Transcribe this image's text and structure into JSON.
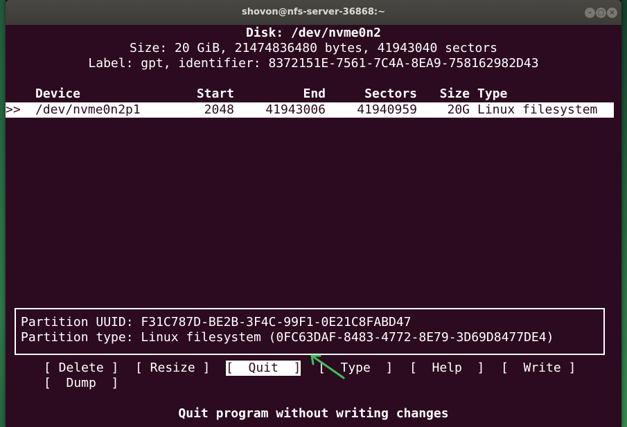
{
  "window": {
    "title": "shovon@nfs-server-36868:~",
    "buttons": {
      "minimize": "–",
      "maximize": "□",
      "close": "×"
    }
  },
  "disk": {
    "header": "Disk: /dev/nvme0n2",
    "size_line": "Size: 20 GiB, 21474836480 bytes, 41943040 sectors",
    "label_line": "Label: gpt, identifier: 8372151E-7561-7C4A-8EA9-758162982D43"
  },
  "table": {
    "columns": [
      "Device",
      "Start",
      "End",
      "Sectors",
      "Size",
      "Type"
    ],
    "rows": [
      {
        "marker": ">>",
        "device": "/dev/nvme0n2p1",
        "start": "2048",
        "end": "41943006",
        "sectors": "41940959",
        "size": "20G",
        "type": "Linux filesystem"
      }
    ]
  },
  "info": {
    "uuid_line": "Partition UUID: F31C787D-BE2B-3F4C-99F1-0E21C8FABD47",
    "type_line": "Partition type: Linux filesystem (0FC63DAF-8483-4772-8E79-3D69D8477DE4)"
  },
  "menu": {
    "delete": "[ Delete ]",
    "resize": "[ Resize ]",
    "quit": "[  Quit  ]",
    "type": "[  Type  ]",
    "help": "[  Help  ]",
    "write": "[  Write ]",
    "dump": "[  Dump  ]"
  },
  "status": "Quit program without writing changes",
  "colors": {
    "terminal_bg": "#2c0a20",
    "text": "#ffffff",
    "arrow": "#3cc05a"
  }
}
